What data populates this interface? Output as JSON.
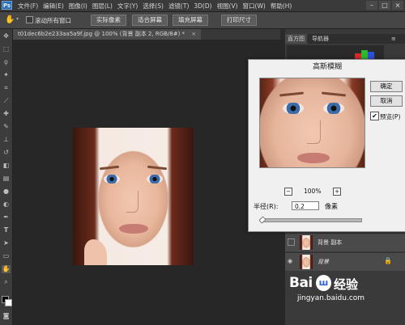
{
  "menubar": {
    "logo": "Ps",
    "items": [
      "文件(F)",
      "编辑(E)",
      "图像(I)",
      "图层(L)",
      "文字(Y)",
      "选择(S)",
      "滤镜(T)",
      "3D(D)",
      "视图(V)",
      "窗口(W)",
      "帮助(H)"
    ],
    "window_buttons": [
      "–",
      "□",
      "×"
    ]
  },
  "options": {
    "scroll_all_label": "滚动所有窗口",
    "btn_actual": "实际像素",
    "btn_fit": "适合屏幕",
    "btn_fill": "填充屏幕",
    "btn_print": "打印尺寸"
  },
  "document": {
    "tab_title": "t01dec6b2e233aa5a9f.jpg @ 100% (背景 副本 2, RGB/8#) *"
  },
  "panels": {
    "tab_histogram": "直方图",
    "tab_navigator": "导航器",
    "layers": [
      {
        "name": "背景 副本"
      },
      {
        "name": "背景"
      }
    ]
  },
  "dialog": {
    "title": "高斯模糊",
    "ok": "确定",
    "cancel": "取消",
    "preview_label": "预览(P)",
    "preview_checked": "✔",
    "zoom_out": "−",
    "zoom_level": "100%",
    "zoom_in": "+",
    "radius_label": "半径(R):",
    "radius_value": "0.2",
    "radius_unit": "像素"
  },
  "watermark": {
    "brand": "Bai",
    "brand2": "经验",
    "url": "jingyan.baidu.com"
  },
  "colors": {
    "accent": "#2a6fb5",
    "baidu_red": "#d0312d",
    "baidu_blue": "#2d5fd3"
  }
}
